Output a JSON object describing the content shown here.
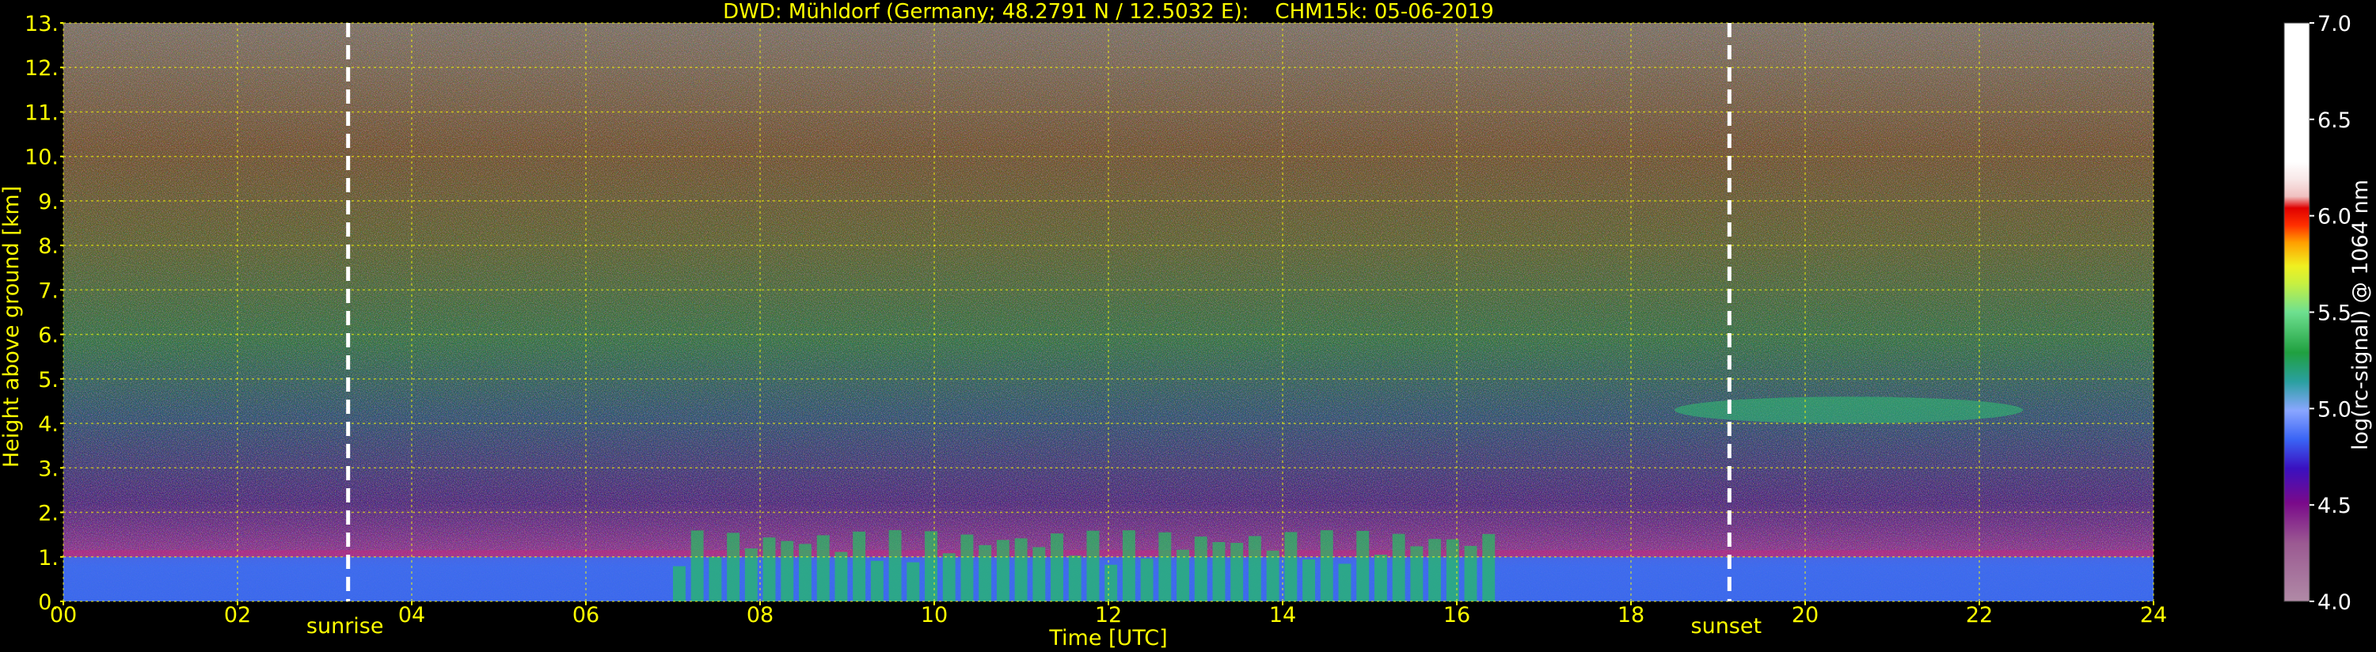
{
  "chart_data": {
    "type": "heatmap",
    "title": "DWD: Mühldorf (Germany; 48.2791 N / 12.5032 E):    CHM15k: 05-06-2019",
    "xlabel": "Time [UTC]",
    "ylabel": "Height above ground [km]",
    "xlim": [
      0,
      24
    ],
    "ylim": [
      0,
      13
    ],
    "xticks": [
      "00",
      "02",
      "04",
      "06",
      "08",
      "10",
      "12",
      "14",
      "16",
      "18",
      "20",
      "22",
      "24"
    ],
    "yticks": [
      "0.",
      "1.",
      "2.",
      "3.",
      "4.",
      "5.",
      "6.",
      "7.",
      "8.",
      "9.",
      "10.",
      "11.",
      "12.",
      "13."
    ],
    "grid": true,
    "annotations": [
      {
        "label": "sunrise",
        "x": 3.27
      },
      {
        "label": "sunset",
        "x": 19.13
      }
    ],
    "colorbar": {
      "label": "log(rc-signal) @ 1064 nm",
      "range": [
        4.0,
        7.0
      ],
      "ticks": [
        "4.0",
        "4.5",
        "5.0",
        "5.5",
        "6.0",
        "6.5",
        "7.0"
      ]
    },
    "features": [
      {
        "desc": "aerosol boundary layer",
        "x": [
          0,
          24
        ],
        "top_km": 1.0
      },
      {
        "desc": "convective cloud fragments",
        "x": [
          7,
          16.5
        ],
        "top_km": 1.6
      },
      {
        "desc": "elevated layer",
        "x": [
          18.5,
          22.5
        ],
        "height_km": [
          4.0,
          4.6
        ]
      }
    ]
  }
}
